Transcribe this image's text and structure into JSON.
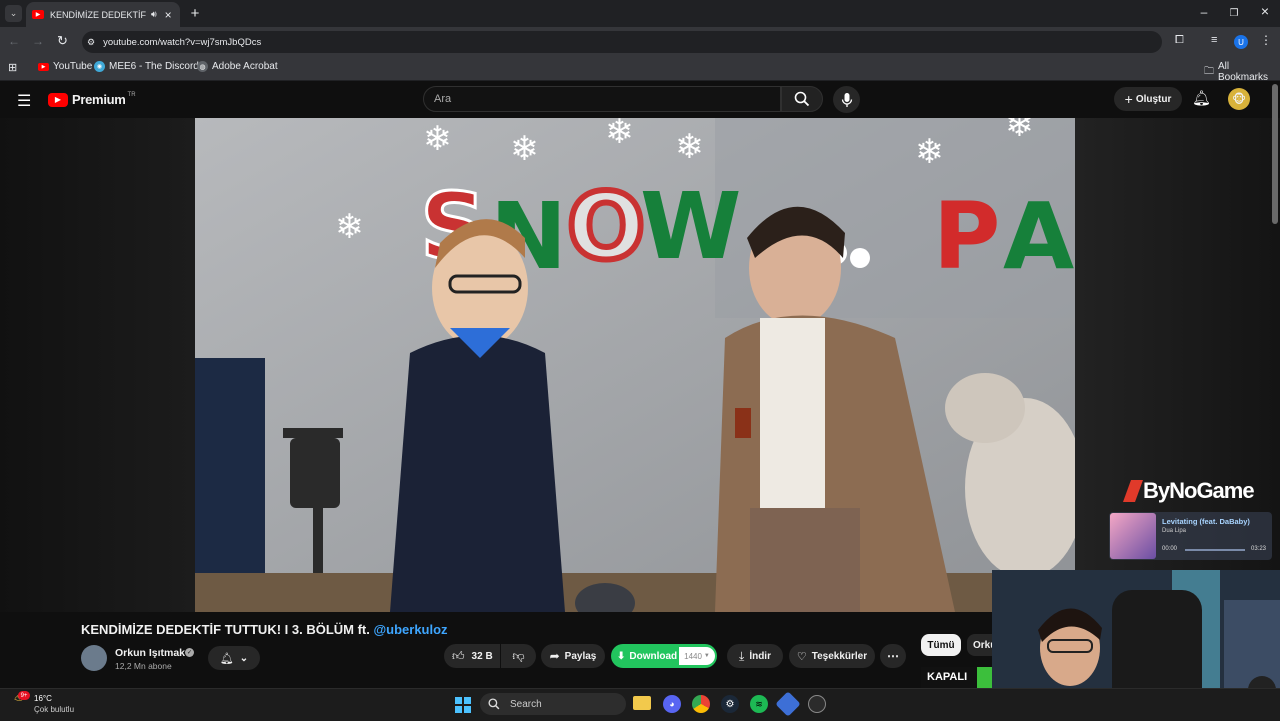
{
  "browser": {
    "tab_title": "KENDİMİZE DEDEKTİF TUTT",
    "url": "youtube.com/watch?v=wj7smJbQDcs",
    "bookmarks": [
      "YouTube",
      "MEE6 - The Discord...",
      "Adobe Acrobat"
    ],
    "all_bookmarks": "All Bookmarks",
    "profile_initial": "U"
  },
  "yt": {
    "logo_text": "Premium",
    "region": "TR",
    "search_placeholder": "Ara",
    "create_label": "Oluştur"
  },
  "video": {
    "title_main": "KENDİMİZE DEDEKTİF TUTTUK! I 3. BÖLÜM ft. ",
    "title_link": "@uberkuloz",
    "channel_name": "Orkun Işıtmak",
    "subscribers": "12,2 Mn abone",
    "likes": "32 B",
    "share_label": "Paylaş",
    "download_ext_label": "Download",
    "download_ext_quality": "1440",
    "download_label": "İndir",
    "thanks_label": "Teşekkürler",
    "overlay_logo": "ByNoGame",
    "sign_text_left": "SNOW",
    "sign_text_right": "PA"
  },
  "side_chips": {
    "all": "Tümü",
    "orku": "Orku",
    "kapali": "KAPALI"
  },
  "music_widget": {
    "track": "Levitating (feat. DaBaby)",
    "artist": "Dua Lipa",
    "elapsed": "00:00",
    "duration": "03:23"
  },
  "taskbar": {
    "weather_temp": "16°C",
    "weather_desc": "Çok bulutlu",
    "search_label": "Search",
    "badge": "9+"
  },
  "colors": {
    "yt_red": "#ff0000",
    "download_green": "#22c55e",
    "link_blue": "#3ea6ff"
  }
}
